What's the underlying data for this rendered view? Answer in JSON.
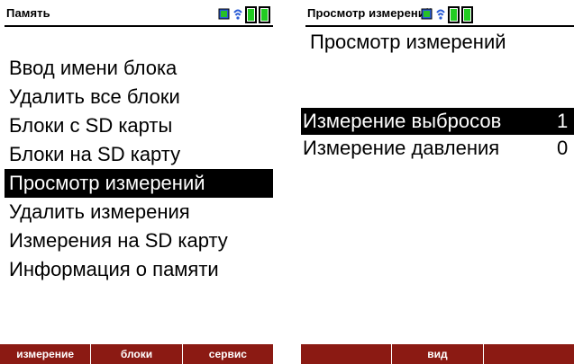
{
  "colors": {
    "softkey_bg": "#8b1a13",
    "battery_green": "#22cc22",
    "signal_blue": "#2a5cd6"
  },
  "memory_screen": {
    "title": "Память",
    "items": [
      {
        "label": "Ввод имени блока"
      },
      {
        "label": "Удалить все блоки"
      },
      {
        "label": "Блоки  с SD карты"
      },
      {
        "label": "Блоки  на SD карту"
      },
      {
        "label": "Просмотр измерений",
        "selected": true
      },
      {
        "label": "Удалить измерения"
      },
      {
        "label": "Измерения на SD карту"
      },
      {
        "label": "Информация о памяти"
      }
    ],
    "softkeys": [
      "измерение",
      "блоки",
      "сервис"
    ]
  },
  "view_screen": {
    "title": "Просмотр измерений",
    "heading": "Просмотр измерений",
    "rows": [
      {
        "label": "Измерение выбросов",
        "count": "1",
        "selected": true
      },
      {
        "label": "Измерение давления",
        "count": "0"
      }
    ],
    "softkeys": [
      "",
      "вид",
      ""
    ]
  },
  "icons": [
    "battery-icon",
    "bluetooth-icon",
    "plug-icon"
  ]
}
